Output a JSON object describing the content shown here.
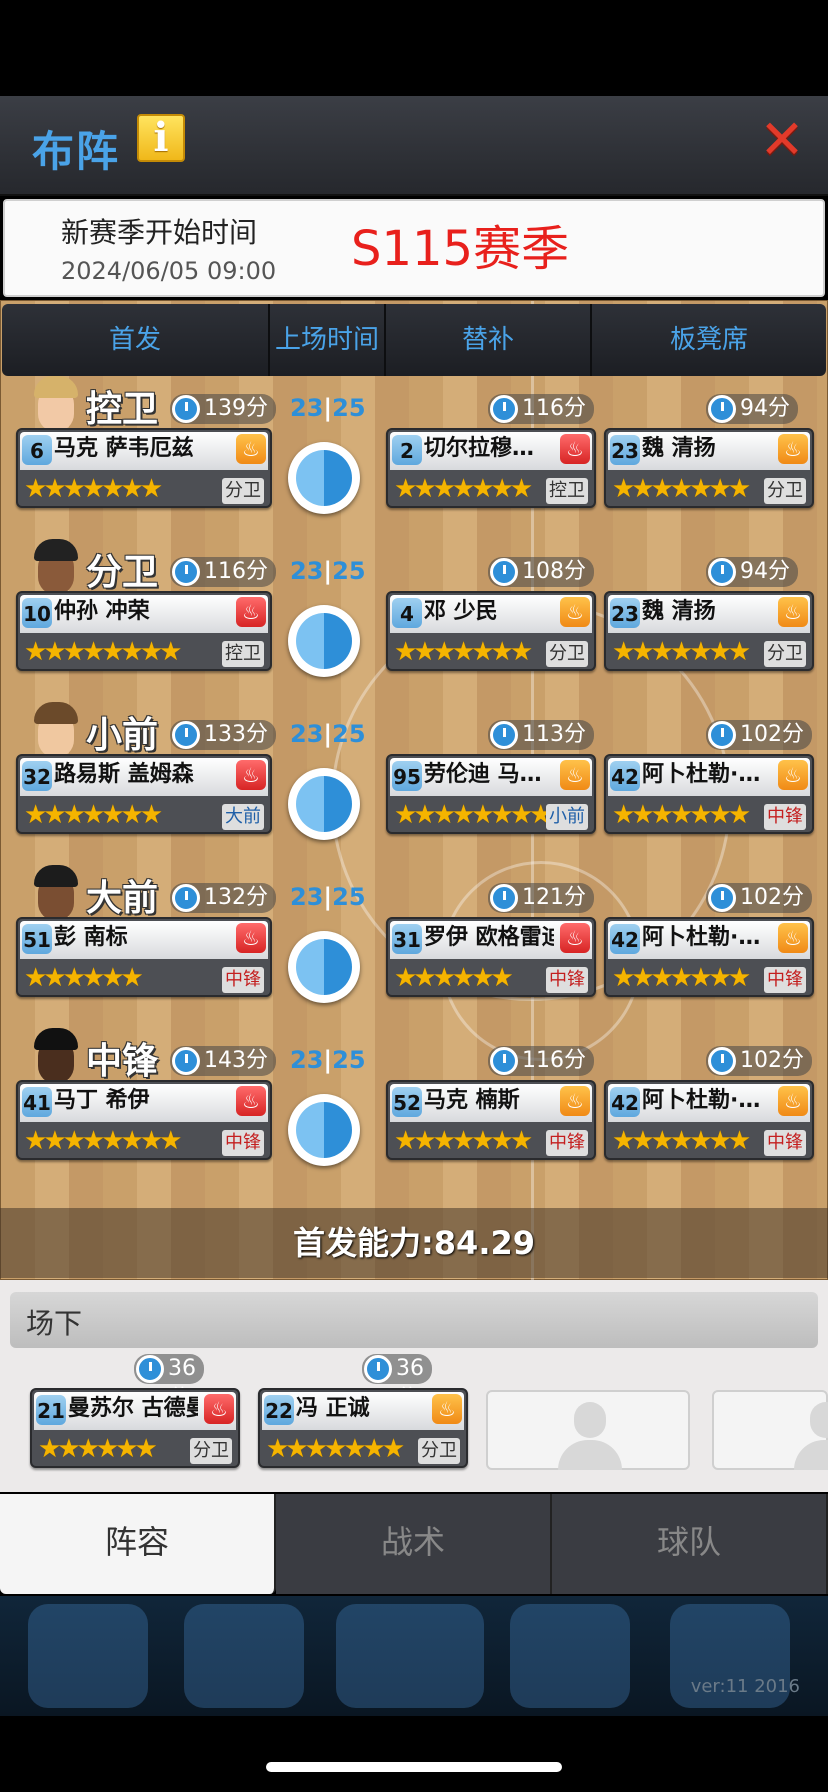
{
  "header": {
    "title": "布阵",
    "info_icon": "i",
    "close_icon": "✕"
  },
  "season": {
    "label": "新赛季开始时间",
    "date": "2024/06/05 09:00",
    "season_name": "S115赛季"
  },
  "tabs": [
    "首发",
    "上场时间",
    "替补",
    "板凳席"
  ],
  "rows": [
    {
      "position": "控卫",
      "minutes_a": "23",
      "minutes_b": "25",
      "starter": {
        "time": "139分",
        "num": "6",
        "name": "马克 萨韦厄兹",
        "state": "warm",
        "stars": "★★★★★★★",
        "pos": "分卫",
        "pos_style": "normal"
      },
      "sub": {
        "time": "116分",
        "num": "2",
        "name": "切尔拉穆…",
        "state": "hot",
        "stars": "★★★★★★★",
        "pos": "控卫",
        "pos_style": "normal"
      },
      "bench": {
        "time": "94分",
        "num": "23",
        "name": "魏 清扬",
        "state": "warm",
        "stars": "★★★★★★★",
        "pos": "分卫",
        "pos_style": "normal"
      }
    },
    {
      "position": "分卫",
      "minutes_a": "23",
      "minutes_b": "25",
      "starter": {
        "time": "116分",
        "num": "10",
        "name": "仲孙 冲荣",
        "state": "hot",
        "stars": "★★★★★★★★",
        "pos": "控卫",
        "pos_style": "normal"
      },
      "sub": {
        "time": "108分",
        "num": "4",
        "name": "邓 少民",
        "state": "warm",
        "stars": "★★★★★★★",
        "pos": "分卫",
        "pos_style": "normal"
      },
      "bench": {
        "time": "94分",
        "num": "23",
        "name": "魏 清扬",
        "state": "warm",
        "stars": "★★★★★★★",
        "pos": "分卫",
        "pos_style": "normal"
      }
    },
    {
      "position": "小前",
      "minutes_a": "23",
      "minutes_b": "25",
      "starter": {
        "time": "133分",
        "num": "32",
        "name": "路易斯 盖姆森",
        "state": "hot",
        "stars": "★★★★★★★",
        "pos": "大前",
        "pos_style": "blue"
      },
      "sub": {
        "time": "113分",
        "num": "95",
        "name": "劳伦迪 马…",
        "state": "warm",
        "stars": "★★★★★★★★",
        "pos": "小前",
        "pos_style": "blue"
      },
      "bench": {
        "time": "102分",
        "num": "42",
        "name": "阿卜杜勒·…",
        "state": "warm",
        "stars": "★★★★★★★",
        "pos": "中锋",
        "pos_style": "red"
      }
    },
    {
      "position": "大前",
      "minutes_a": "23",
      "minutes_b": "25",
      "starter": {
        "time": "132分",
        "num": "51",
        "name": "彭 南标",
        "state": "hot",
        "stars": "★★★★★★",
        "pos": "中锋",
        "pos_style": "red"
      },
      "sub": {
        "time": "121分",
        "num": "31",
        "name": "罗伊 欧格雷迪",
        "state": "hot",
        "stars": "★★★★★★",
        "pos": "中锋",
        "pos_style": "red"
      },
      "bench": {
        "time": "102分",
        "num": "42",
        "name": "阿卜杜勒·…",
        "state": "warm",
        "stars": "★★★★★★★",
        "pos": "中锋",
        "pos_style": "red"
      }
    },
    {
      "position": "中锋",
      "minutes_a": "23",
      "minutes_b": "25",
      "starter": {
        "time": "143分",
        "num": "41",
        "name": "马丁 希伊",
        "state": "hot",
        "stars": "★★★★★★★★",
        "pos": "中锋",
        "pos_style": "red"
      },
      "sub": {
        "time": "116分",
        "num": "52",
        "name": "马克 楠斯",
        "state": "warm",
        "stars": "★★★★★★★",
        "pos": "中锋",
        "pos_style": "red"
      },
      "bench": {
        "time": "102分",
        "num": "42",
        "name": "阿卜杜勒·…",
        "state": "warm",
        "stars": "★★★★★★★",
        "pos": "中锋",
        "pos_style": "red"
      }
    }
  ],
  "power": {
    "label": "首发能力:84.29"
  },
  "bench_section": {
    "title": "场下",
    "players": [
      {
        "time": "36分",
        "num": "21",
        "name": "曼苏尔 古德曼",
        "state": "hot",
        "stars": "★★★★★★",
        "pos": "分卫",
        "pos_style": "normal"
      },
      {
        "time": "36分",
        "num": "22",
        "name": "冯 正诚",
        "state": "warm",
        "stars": "★★★★★★★",
        "pos": "分卫",
        "pos_style": "normal"
      }
    ]
  },
  "bottom_tabs": [
    "阵容",
    "战术",
    "球队"
  ],
  "version": "ver:11  2016",
  "colors": {
    "accent": "#4aa3e8",
    "season_red": "#e8201c",
    "hot": "#d72424",
    "warm": "#f08a16"
  }
}
